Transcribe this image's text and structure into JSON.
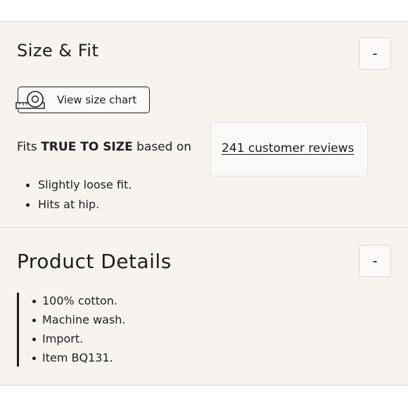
{
  "size_fit": {
    "title": "Size & Fit",
    "toggle_label": "-",
    "size_chart_label": "View size chart",
    "fits_prefix": "Fits",
    "fits_value": "TRUE TO SIZE",
    "fits_suffix": "based on",
    "reviews_link": "241 customer reviews",
    "bullets": [
      "Slightly loose fit.",
      "Hits at hip."
    ]
  },
  "product_details": {
    "title": "Product Details",
    "toggle_label": "-",
    "bullets": [
      "100% cotton.",
      "Machine wash.",
      "Import.",
      "Item BQ131."
    ]
  },
  "icons": {
    "size_chart": "measuring-tape-icon",
    "collapse": "minus-icon"
  }
}
